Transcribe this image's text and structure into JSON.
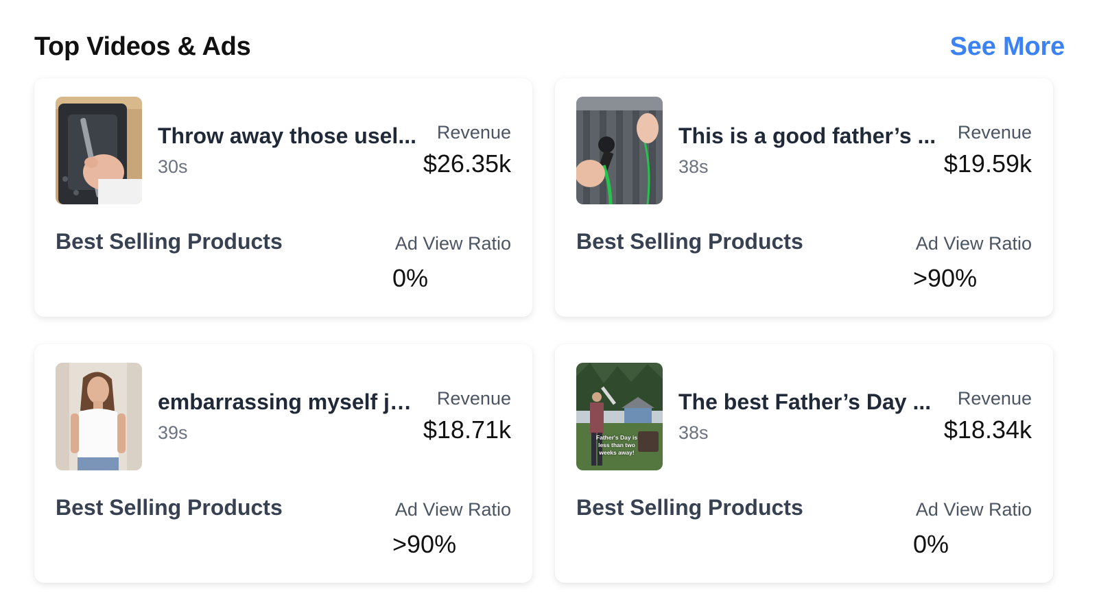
{
  "header": {
    "title": "Top Videos & Ads",
    "see_more": "See More"
  },
  "colors": {
    "accent": "#3b82f6"
  },
  "cards": [
    {
      "title": "Throw away those usel...",
      "duration": "30s",
      "revenue_label": "Revenue",
      "revenue": "$26.35k",
      "products_label": "Best Selling Products",
      "ratio_label": "Ad View Ratio",
      "ratio": "0%",
      "thumb_icon": "hand-tool-icon"
    },
    {
      "title": "This is a good father’s ...",
      "duration": "38s",
      "revenue_label": "Revenue",
      "revenue": "$19.59k",
      "products_label": "Best Selling Products",
      "ratio_label": "Ad View Ratio",
      "ratio": ">90%",
      "thumb_icon": "truck-bed-icon"
    },
    {
      "title": "embarrassing myself ju...",
      "duration": "39s",
      "revenue_label": "Revenue",
      "revenue": "$18.71k",
      "products_label": "Best Selling Products",
      "ratio_label": "Ad View Ratio",
      "ratio": ">90%",
      "thumb_icon": "person-icon"
    },
    {
      "title": "The best Father’s Day ...",
      "duration": "38s",
      "revenue_label": "Revenue",
      "revenue": "$18.34k",
      "products_label": "Best Selling Products",
      "ratio_label": "Ad View Ratio",
      "ratio": "0%",
      "thumb_icon": "backyard-icon",
      "thumb_caption": "Father's Day is less than two weeks away!"
    }
  ]
}
